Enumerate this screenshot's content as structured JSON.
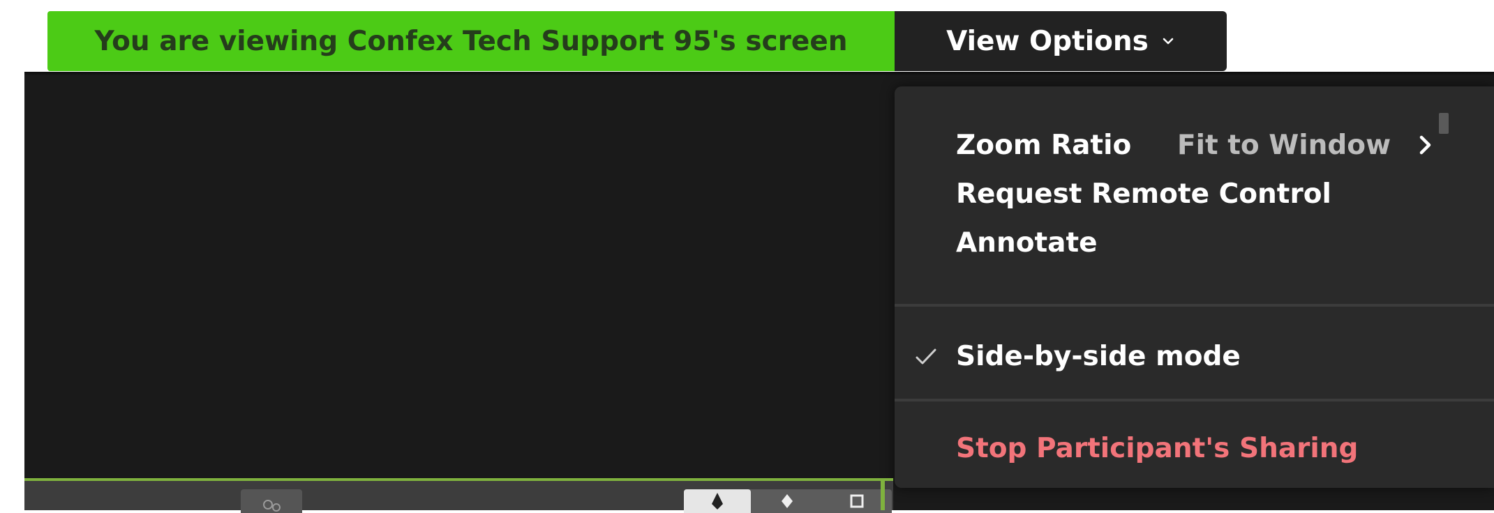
{
  "banner": {
    "text": "You are viewing Confex Tech Support 95's screen",
    "color": "#4ccb16"
  },
  "view_options": {
    "label": "View Options",
    "icon": "chevron-down-icon"
  },
  "menu": {
    "zoom_ratio": {
      "label": "Zoom Ratio",
      "value": "Fit to Window",
      "icon": "chevron-right-icon"
    },
    "request_remote_control": {
      "label": "Request Remote Control"
    },
    "annotate": {
      "label": "Annotate"
    },
    "side_by_side": {
      "label": "Side-by-side mode",
      "checked": true,
      "icon": "checkmark-icon"
    },
    "stop_sharing": {
      "label": "Stop Participant's Sharing",
      "color": "#f2747a"
    }
  },
  "toolbar": {
    "icons": [
      "person-icon",
      "pen-icon",
      "pointer-icon",
      "square-icon"
    ]
  }
}
